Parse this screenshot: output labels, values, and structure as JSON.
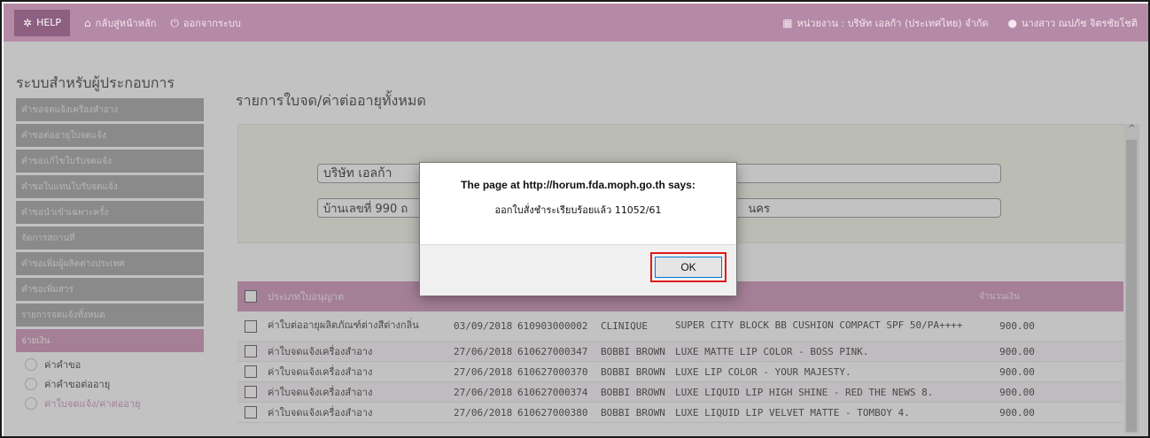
{
  "topbar": {
    "help_label": "HELP",
    "home_label": "กลับสู่หน้าหลัก",
    "logout_label": "ออกจากระบบ",
    "agency_label": "หน่วยงาน : บริษัท เอลก้า (ประเทศไทย) จำกัด",
    "user_label": "นางสาว ณปภัช จิตรชัยโชติ"
  },
  "sidebar": {
    "title": "ระบบสำหรับผู้ประกอบการ",
    "items": [
      {
        "label": "คำขอจดแจ้งเครื่องสำอาง"
      },
      {
        "label": "คำขอต่ออายุใบจดแจ้ง"
      },
      {
        "label": "คำขอแก้ไขใบรับจดแจ้ง"
      },
      {
        "label": "คำขอใบแทนใบรับจดแจ้ง"
      },
      {
        "label": "คำขอนำเข้าเฉพาะครั้ง"
      },
      {
        "label": "จัดการสถานที่"
      },
      {
        "label": "คำขอเพิ่มผู้ผลิตต่างประเทศ"
      },
      {
        "label": "คำขอเพิ่มสาร"
      },
      {
        "label": "รายการจดแจ้งทั้งหมด"
      },
      {
        "label": "จ่ายเงิน"
      }
    ],
    "sub_items": [
      {
        "label": "ค่าคำขอ"
      },
      {
        "label": "ค่าคำขอต่ออายุ"
      },
      {
        "label": "ค่าใบจดแจ้ง/ค่าต่ออายุ"
      }
    ]
  },
  "main": {
    "title": "รายการใบจด/ค่าต่ออายุทั้งหมด",
    "company_name": "บริษัท เอลก้า",
    "company_name_tail": "",
    "address": "บ้านเลขที่ 990 ถ",
    "address_tail": "นคร"
  },
  "table": {
    "headers": {
      "type": "ประเภทใบอนุญาต",
      "amount": "จำนวนเงิน"
    },
    "rows": [
      {
        "type": "ค่าใบต่ออายุผลิตภัณฑ์ต่างสีต่างกลิ่น",
        "date": "03/09/2018",
        "no": "610903000002",
        "brand": "CLINIQUE",
        "product": "SUPER CITY BLOCK BB CUSHION COMPACT SPF 50/PA++++",
        "amount": "900.00"
      },
      {
        "type": "ค่าใบจดแจ้งเครื่องสำอาง",
        "date": "27/06/2018",
        "no": "610627000347",
        "brand": "BOBBI BROWN",
        "product": "LUXE MATTE LIP COLOR - BOSS PINK.",
        "amount": "900.00"
      },
      {
        "type": "ค่าใบจดแจ้งเครื่องสำอาง",
        "date": "27/06/2018",
        "no": "610627000370",
        "brand": "BOBBI BROWN",
        "product": "LUXE LIP COLOR - YOUR MAJESTY.",
        "amount": "900.00"
      },
      {
        "type": "ค่าใบจดแจ้งเครื่องสำอาง",
        "date": "27/06/2018",
        "no": "610627000374",
        "brand": "BOBBI BROWN",
        "product": "LUXE LIQUID LIP HIGH SHINE - RED THE NEWS 8.",
        "amount": "900.00"
      },
      {
        "type": "ค่าใบจดแจ้งเครื่องสำอาง",
        "date": "27/06/2018",
        "no": "610627000380",
        "brand": "BOBBI BROWN",
        "product": "LUXE LIQUID LIP VELVET MATTE - TOMBOY 4.",
        "amount": "900.00"
      }
    ]
  },
  "dialog": {
    "title": "The page at http://horum.fda.moph.go.th says:",
    "message": "ออกใบสั่งชำระเรียบร้อยแล้ว 11052/61",
    "ok_label": "OK"
  },
  "colors": {
    "topbar": "#b58aa6",
    "accent_pink": "#c985b0",
    "ok_highlight": "#e01b1b"
  },
  "icons": [
    "gear-icon",
    "home-icon",
    "power-icon",
    "building-icon",
    "user-icon"
  ]
}
